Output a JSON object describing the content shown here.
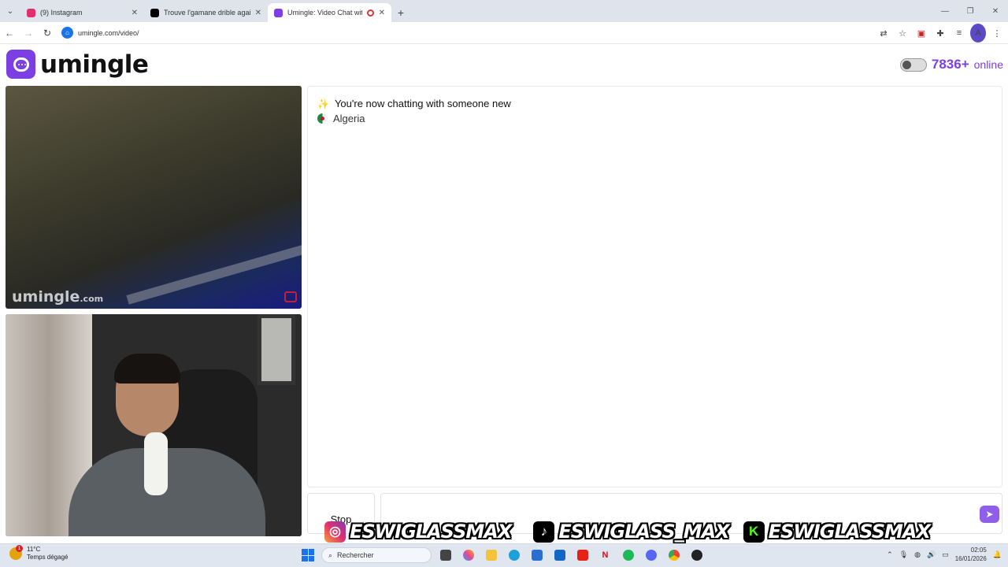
{
  "browser": {
    "tabs": [
      {
        "label": "(9) Instagram",
        "favicon_color": "#e1306c",
        "active": false
      },
      {
        "label": "Trouve l'gamane drible against",
        "favicon_color": "#000000",
        "active": false
      },
      {
        "label": "Umingle: Video Chat with S",
        "favicon_color": "#7b3fe4",
        "active": true
      }
    ],
    "new_tab_icon": "plus-icon",
    "address": "umingle.com/video/"
  },
  "site": {
    "brand": "umingle",
    "online_count": "7836+",
    "online_label": "online",
    "accent_color": "#7b3fe4"
  },
  "remote_video": {
    "watermark_main": "umingle",
    "watermark_tld": ".com"
  },
  "chat": {
    "status_message": "You're now chatting with someone new",
    "country": "Algeria"
  },
  "controls": {
    "stop_label": "Stop",
    "message_placeholder": ""
  },
  "overlay": {
    "handles": [
      {
        "platform": "instagram",
        "text": "ESWIGLASSMAX"
      },
      {
        "platform": "tiktok",
        "text": "ESWIGLASS_MAX"
      },
      {
        "platform": "kick",
        "text": "ESWIGLASSMAX",
        "glyph": "K"
      }
    ]
  },
  "taskbar": {
    "weather_temp": "11°C",
    "weather_desc": "Temps dégagé",
    "weather_badge": "1",
    "search_placeholder": "Rechercher",
    "time": "02:05",
    "date": "16/01/2026"
  }
}
